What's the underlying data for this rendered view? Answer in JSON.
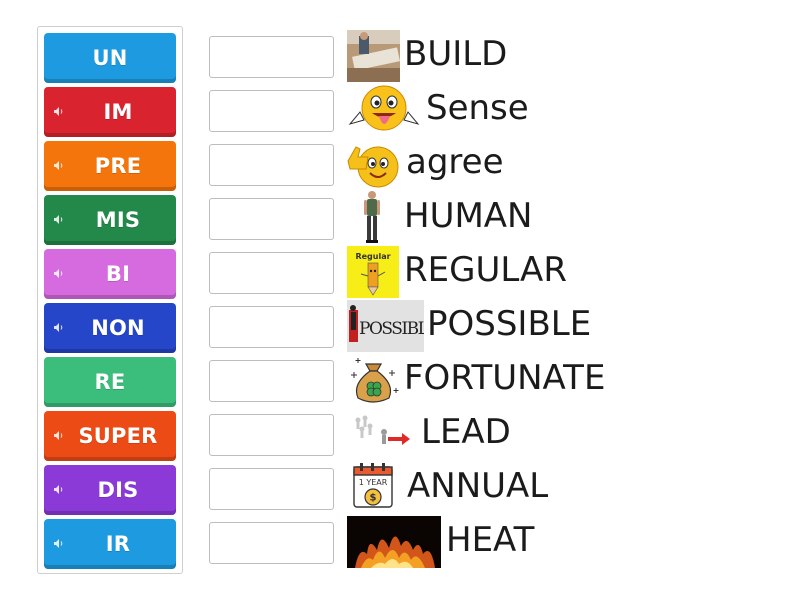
{
  "tiles": [
    {
      "label": "UN",
      "color": "#1e9be0",
      "sound": false
    },
    {
      "label": "IM",
      "color": "#d9242f",
      "sound": true
    },
    {
      "label": "PRE",
      "color": "#f4750b",
      "sound": true
    },
    {
      "label": "MIS",
      "color": "#23894a",
      "sound": true
    },
    {
      "label": "BI",
      "color": "#d66be0",
      "sound": true
    },
    {
      "label": "NON",
      "color": "#2546c8",
      "sound": true
    },
    {
      "label": "RE",
      "color": "#3bbe7c",
      "sound": false
    },
    {
      "label": "SUPER",
      "color": "#ec4b16",
      "sound": true
    },
    {
      "label": "DIS",
      "color": "#8b3ad8",
      "sound": true
    },
    {
      "label": "IR",
      "color": "#1e9be0",
      "sound": true
    }
  ],
  "rows": [
    {
      "word": "BUILD",
      "image": "construction-photo"
    },
    {
      "word": "Sense",
      "image": "tongue-out-emoji"
    },
    {
      "word": "agree",
      "image": "thumbs-up-emoji"
    },
    {
      "word": "HUMAN",
      "image": "standing-person"
    },
    {
      "word": "REGULAR",
      "image": "regular-pencil-cartoon"
    },
    {
      "word": "POSSIBLE",
      "image": "impossible-sign"
    },
    {
      "word": "FORTUNATE",
      "image": "lucky-money-bag-icon"
    },
    {
      "word": "LEAD",
      "image": "leader-arrow-icon"
    },
    {
      "word": "ANNUAL",
      "image": "one-year-calendar-icon"
    },
    {
      "word": "HEAT",
      "image": "fire-photo"
    }
  ],
  "calendar_text": "1 YEAR",
  "regular_text": "Regular",
  "impossible_text": "POSSIBLE"
}
